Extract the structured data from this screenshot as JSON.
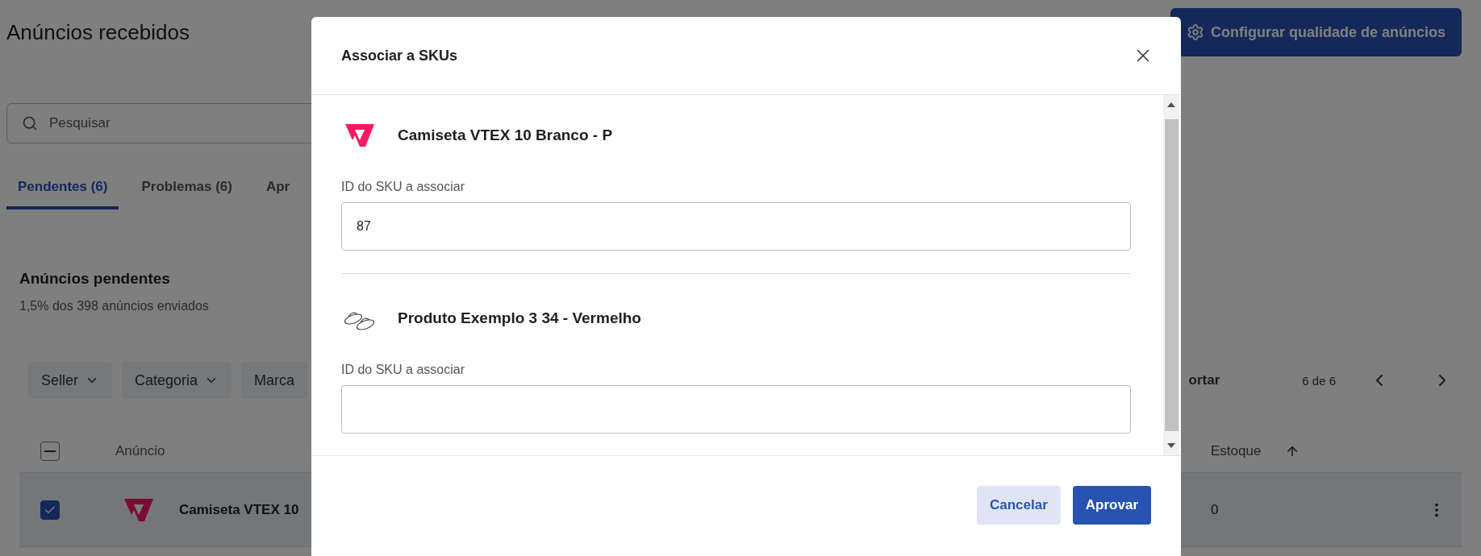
{
  "page": {
    "title": "Anúncios recebidos",
    "config_button": "Configurar qualidade de anúncios",
    "search": {
      "placeholder": "Pesquisar"
    },
    "tabs": [
      {
        "label": "Pendentes (6)",
        "selected": true
      },
      {
        "label": "Problemas (6)",
        "selected": false
      },
      {
        "label": "Apr",
        "selected": false
      }
    ],
    "section": {
      "title": "Anúncios pendentes",
      "subtitle": "1,5% dos 398 anúncios enviados"
    },
    "filters": [
      "Seller",
      "Categoria",
      "Marca"
    ],
    "toolbar": {
      "action": "ortar",
      "pagination": "6 de 6"
    },
    "table": {
      "header_checkbox": {
        "indeterminate": true
      },
      "columns": [
        {
          "label": "Anúncio"
        },
        {
          "label": "Estoque",
          "sorted": true
        }
      ],
      "rows": [
        {
          "selected": true,
          "name": "Camiseta VTEX 10",
          "stock": "0"
        }
      ]
    }
  },
  "modal": {
    "title": "Associar a SKUs",
    "items": [
      {
        "kind": "logo",
        "name": "Camiseta VTEX 10 Branco - P",
        "label": "ID do SKU a associar",
        "value": "87"
      },
      {
        "kind": "picture",
        "name": "Produto Exemplo 3 34 - Vermelho",
        "label": "ID do SKU a associar",
        "value": ""
      }
    ],
    "buttons": [
      {
        "label": "Cancelar",
        "kind": "secondary"
      },
      {
        "label": "Aprovar",
        "kind": "primary"
      }
    ]
  }
}
